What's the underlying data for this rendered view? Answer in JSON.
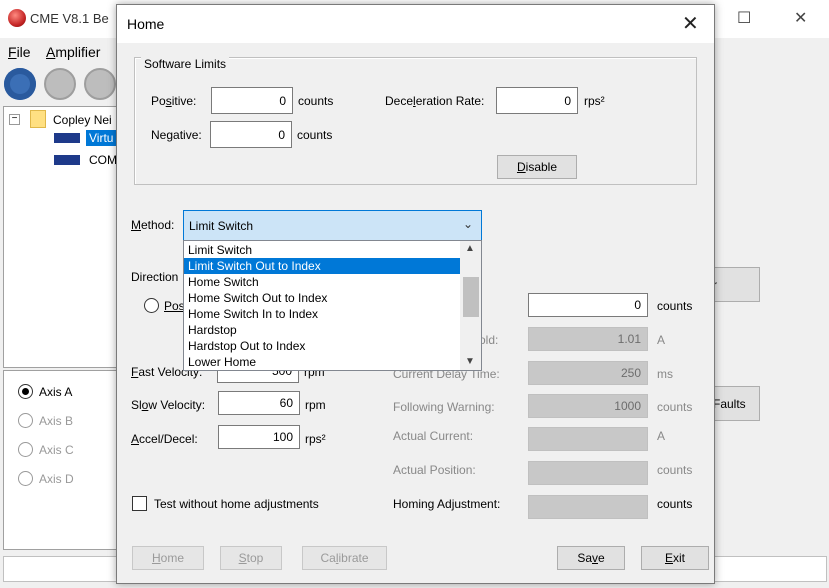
{
  "main": {
    "title": "CME V8.1 Be",
    "menu": [
      "File",
      "Amplifier"
    ],
    "tree": {
      "root": "Copley Nei",
      "child1": "Virtu",
      "child2": "COM"
    },
    "axes": [
      "Axis A",
      "Axis B",
      "Axis C",
      "Axis D"
    ],
    "bg_button_right_top": "r",
    "bg_button_faults": "Faults"
  },
  "dialog": {
    "title": "Home",
    "software_limits": {
      "legend": "Software Limits",
      "positive_label": "Positive:",
      "positive_value": "0",
      "positive_unit": "counts",
      "negative_label": "Negative:",
      "negative_value": "0",
      "negative_unit": "counts",
      "decel_label": "Deceleration Rate:",
      "decel_value": "0",
      "decel_unit": "rps²",
      "disable_button": "Disable"
    },
    "method": {
      "label": "Method:",
      "selected": "Limit Switch",
      "options": [
        "Limit Switch",
        "Limit Switch Out to Index",
        "Home Switch",
        "Home Switch Out to Index",
        "Home Switch In to Index",
        "Hardstop",
        "Hardstop Out to Index",
        "Lower Home"
      ],
      "highlighted_index": 1
    },
    "direction_label": "Direction",
    "positive_radio": "Pos",
    "offset": {
      "value": "0",
      "unit": "counts"
    },
    "hardstop_threshold": {
      "label_partial": "old:",
      "value": "1.01",
      "unit": "A"
    },
    "fast_velocity": {
      "label": "Fast Velocity:",
      "value_partial": "500",
      "unit": "rpm"
    },
    "current_delay": {
      "label": "Current Delay Time:",
      "value": "250",
      "unit": "ms"
    },
    "slow_velocity": {
      "label": "Slow Velocity:",
      "value": "60",
      "unit": "rpm"
    },
    "following_warning": {
      "label": "Following Warning:",
      "value": "1000",
      "unit": "counts"
    },
    "accel_decel": {
      "label": "Accel/Decel:",
      "value": "100",
      "unit": "rps²"
    },
    "actual_current": {
      "label": "Actual Current:",
      "value": "",
      "unit": "A"
    },
    "actual_position": {
      "label": "Actual Position:",
      "value": "",
      "unit": "counts"
    },
    "test_checkbox_label": "Test without home adjustments",
    "homing_adjustment": {
      "label": "Homing Adjustment:",
      "value": "",
      "unit": "counts"
    },
    "buttons": {
      "home": "Home",
      "stop": "Stop",
      "calibrate": "Calibrate",
      "save": "Save",
      "exit": "Exit"
    }
  }
}
